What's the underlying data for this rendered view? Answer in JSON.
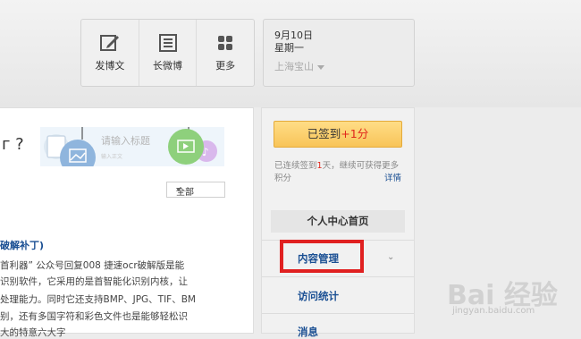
{
  "toolbar": {
    "items": [
      {
        "label": "发博文",
        "icon": "edit-icon"
      },
      {
        "label": "长微博",
        "icon": "long-post-icon"
      },
      {
        "label": "更多",
        "icon": "grid-icon"
      }
    ]
  },
  "datebox": {
    "date": "9月10日",
    "weekday": "星期一",
    "location": "上海宝山"
  },
  "main": {
    "question_mark": "г ?",
    "title_placeholder": "请输入标题",
    "body_placeholder": "输入正文",
    "filter_value": "全部",
    "article": {
      "title": "破解补丁)",
      "lines": [
        "首利器” 公众号回复008  捷速ocr破解版是能",
        "识别软件，它采用的是首智能化识别内核，让",
        "处理能力。同时它还支持BMP、JPG、TIF、BM",
        "别，还有多国字符和彩色文件也是能够轻松识",
        "大的特意六大字"
      ]
    }
  },
  "sidebar": {
    "signin_label": "已签到",
    "signin_plus": "+1分",
    "note_prefix": "已连续签到",
    "note_days": "1",
    "note_suffix": "天，继续可获得更多",
    "note_line2": "积分",
    "details_link": "详情",
    "menu_header": "个人中心首页",
    "menu_items": [
      "内容管理",
      "访问统计",
      "消息"
    ]
  },
  "watermark": {
    "text": "Bai 经验",
    "url": "jingyan.baidu.com"
  },
  "colors": {
    "link_blue": "#1a4f93",
    "highlight_red": "#e02020",
    "signin_gold": "#f8c459"
  }
}
